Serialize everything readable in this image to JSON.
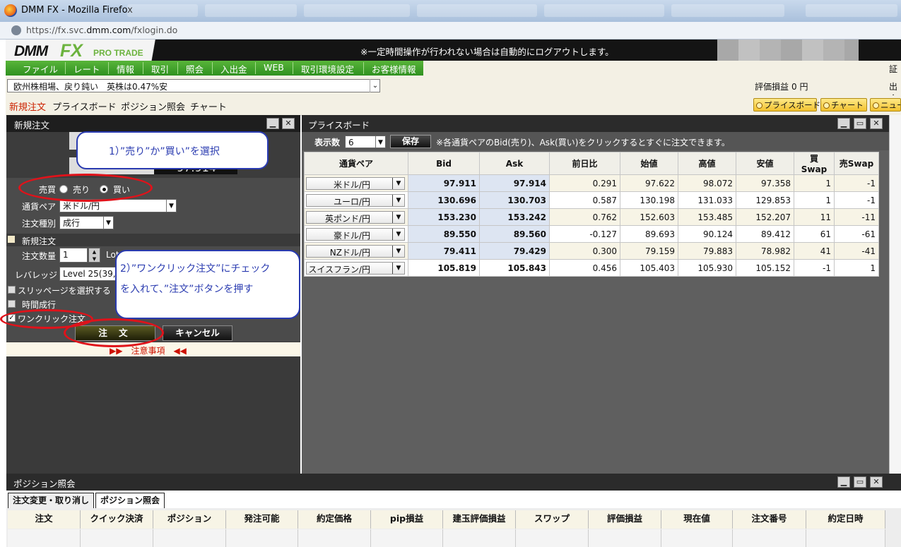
{
  "browser": {
    "window_title": "DMM FX - Mozilla Firefox",
    "url_prefix": "https://fx.svc.",
    "url_domain": "dmm.com",
    "url_path": "/fxlogin.do"
  },
  "header": {
    "logo_dmm": "DMM",
    "logo_fx": "FX",
    "logo_pro": "PRO TRADE",
    "logout_notice": "※一定時間操作が行われない場合は自動的にログアウトします。"
  },
  "menu": [
    "ファイル",
    "レート",
    "情報",
    "取引",
    "照会",
    "入出金",
    "WEB",
    "取引環境設定",
    "お客様情報"
  ],
  "menu_right_label": "証拠",
  "news": {
    "headline": "欧州株相場、戻り鈍い　英株は0.47%安",
    "pl_label": "評価損益",
    "pl_value": "0 円",
    "right_label": "出金"
  },
  "tabs": [
    "新規注文",
    "プライスボード",
    "ポジション照会",
    "チャート"
  ],
  "quick_buttons": [
    "プライスボード",
    "チャート",
    "ニュー"
  ],
  "order_panel": {
    "title": "新規注文",
    "rate_digits": "97.914",
    "label_buysell": "売買",
    "label_sell": "売り",
    "label_buy": "買い",
    "label_pair": "通貨ペア",
    "pair_value": "米ドル/円",
    "label_type": "注文種別",
    "type_value": "成行",
    "label_new_order": "新規注文",
    "label_qty": "注文数量",
    "qty_value": "1",
    "qty_unit": "Lot",
    "label_leverage": "レバレッジ",
    "leverage_value": "Level 25(39,",
    "label_slippage": "スリッページを選択する",
    "label_time": "時間成行",
    "label_oneclick": "ワンクリック注文",
    "btn_order": "注 文",
    "btn_cancel": "キャンセル",
    "notes": "▶▶　注意事項　◀◀"
  },
  "callouts": {
    "one": "1）”売り”か”買い”を選択",
    "two_line1": "2）”ワンクリック注文”にチェック",
    "two_line2": "を入れて、”注文”ボタンを押す"
  },
  "priceboard": {
    "title": "プライスボード",
    "disp_label": "表示数",
    "disp_value": "6",
    "save_label": "保存",
    "note": "※各通貨ペアのBid(売り)、Ask(買い)をクリックするとすぐに注文できます。",
    "columns": [
      "通貨ペア",
      "Bid",
      "Ask",
      "前日比",
      "始値",
      "高値",
      "安値",
      "買Swap",
      "売Swap"
    ],
    "rows": [
      {
        "pair": "米ドル/円",
        "bid": "97.911",
        "ask": "97.914",
        "change": "0.291",
        "open": "97.622",
        "high": "98.072",
        "low": "97.358",
        "buy_swap": "1",
        "sell_swap": "-1"
      },
      {
        "pair": "ユーロ/円",
        "bid": "130.696",
        "ask": "130.703",
        "change": "0.587",
        "open": "130.198",
        "high": "131.033",
        "low": "129.853",
        "buy_swap": "1",
        "sell_swap": "-1"
      },
      {
        "pair": "英ポンド/円",
        "bid": "153.230",
        "ask": "153.242",
        "change": "0.762",
        "open": "152.603",
        "high": "153.485",
        "low": "152.207",
        "buy_swap": "11",
        "sell_swap": "-11"
      },
      {
        "pair": "豪ドル/円",
        "bid": "89.550",
        "ask": "89.560",
        "change": "-0.127",
        "open": "89.693",
        "high": "90.124",
        "low": "89.412",
        "buy_swap": "61",
        "sell_swap": "-61"
      },
      {
        "pair": "NZドル/円",
        "bid": "79.411",
        "ask": "79.429",
        "change": "0.300",
        "open": "79.159",
        "high": "79.883",
        "low": "78.982",
        "buy_swap": "41",
        "sell_swap": "-41"
      },
      {
        "pair": "スイスフラン/円",
        "bid": "105.819",
        "ask": "105.843",
        "change": "0.456",
        "open": "105.403",
        "high": "105.930",
        "low": "105.152",
        "buy_swap": "-1",
        "sell_swap": "1"
      }
    ]
  },
  "positions": {
    "title": "ポジション照会",
    "tab_modify": "注文変更・取り消し",
    "tab_positions": "ポジション照会",
    "columns": [
      "注文",
      "クイック決済",
      "ポジション",
      "発注可能",
      "約定価格",
      "pip損益",
      "建玉評価損益",
      "スワップ",
      "評価損益",
      "現在値",
      "注文番号",
      "約定日時"
    ]
  }
}
